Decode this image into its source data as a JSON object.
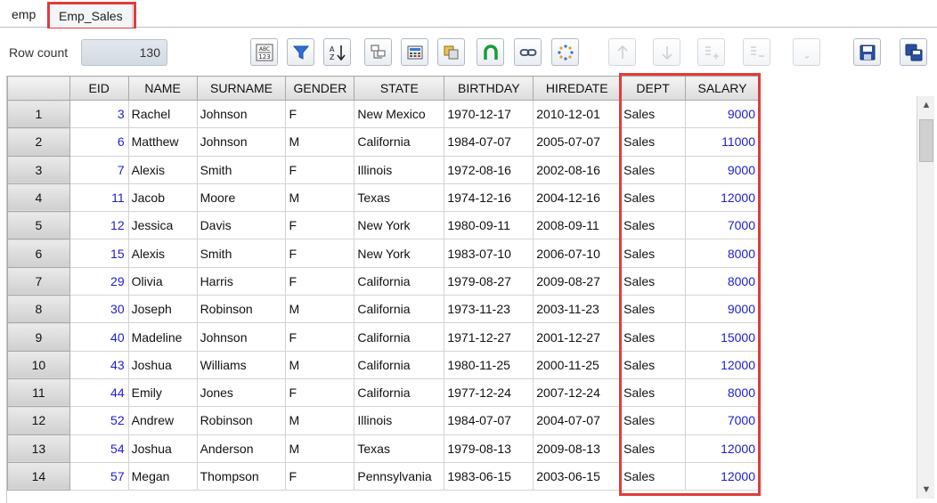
{
  "tabs": [
    {
      "label": "emp"
    },
    {
      "label": "Emp_Sales"
    }
  ],
  "toolbar": {
    "row_count_label": "Row count",
    "row_count_value": "130",
    "buttons": [
      {
        "icon": "abc-123-icon"
      },
      {
        "icon": "filter-icon"
      },
      {
        "icon": "sort-az-icon"
      },
      {
        "icon": "group-icon"
      },
      {
        "icon": "calculator-icon"
      },
      {
        "icon": "copy-icon"
      },
      {
        "icon": "magnet-icon"
      },
      {
        "icon": "link-icon"
      },
      {
        "icon": "dots-circle-icon"
      },
      {
        "icon": "move-up-icon"
      },
      {
        "icon": "move-down-icon"
      },
      {
        "icon": "insert-row-icon"
      },
      {
        "icon": "delete-row-icon"
      },
      {
        "icon": "blank-icon"
      },
      {
        "icon": "save-icon"
      },
      {
        "icon": "save-as-icon"
      }
    ]
  },
  "grid": {
    "columns": [
      "EID",
      "NAME",
      "SURNAME",
      "GENDER",
      "STATE",
      "BIRTHDAY",
      "HIREDATE",
      "DEPT",
      "SALARY"
    ],
    "rows": [
      {
        "n": "1",
        "eid": "3",
        "name": "Rachel",
        "surname": "Johnson",
        "gender": "F",
        "state": "New Mexico",
        "birthday": "1970-12-17",
        "hiredate": "2010-12-01",
        "dept": "Sales",
        "salary": "9000"
      },
      {
        "n": "2",
        "eid": "6",
        "name": "Matthew",
        "surname": "Johnson",
        "gender": "M",
        "state": "California",
        "birthday": "1984-07-07",
        "hiredate": "2005-07-07",
        "dept": "Sales",
        "salary": "11000"
      },
      {
        "n": "3",
        "eid": "7",
        "name": "Alexis",
        "surname": "Smith",
        "gender": "F",
        "state": "Illinois",
        "birthday": "1972-08-16",
        "hiredate": "2002-08-16",
        "dept": "Sales",
        "salary": "9000"
      },
      {
        "n": "4",
        "eid": "11",
        "name": "Jacob",
        "surname": "Moore",
        "gender": "M",
        "state": "Texas",
        "birthday": "1974-12-16",
        "hiredate": "2004-12-16",
        "dept": "Sales",
        "salary": "12000"
      },
      {
        "n": "5",
        "eid": "12",
        "name": "Jessica",
        "surname": "Davis",
        "gender": "F",
        "state": "New York",
        "birthday": "1980-09-11",
        "hiredate": "2008-09-11",
        "dept": "Sales",
        "salary": "7000"
      },
      {
        "n": "6",
        "eid": "15",
        "name": "Alexis",
        "surname": "Smith",
        "gender": "F",
        "state": "New York",
        "birthday": "1983-07-10",
        "hiredate": "2006-07-10",
        "dept": "Sales",
        "salary": "8000"
      },
      {
        "n": "7",
        "eid": "29",
        "name": "Olivia",
        "surname": "Harris",
        "gender": "F",
        "state": "California",
        "birthday": "1979-08-27",
        "hiredate": "2009-08-27",
        "dept": "Sales",
        "salary": "8000"
      },
      {
        "n": "8",
        "eid": "30",
        "name": "Joseph",
        "surname": "Robinson",
        "gender": "M",
        "state": "California",
        "birthday": "1973-11-23",
        "hiredate": "2003-11-23",
        "dept": "Sales",
        "salary": "9000"
      },
      {
        "n": "9",
        "eid": "40",
        "name": "Madeline",
        "surname": "Johnson",
        "gender": "F",
        "state": "California",
        "birthday": "1971-12-27",
        "hiredate": "2001-12-27",
        "dept": "Sales",
        "salary": "15000"
      },
      {
        "n": "10",
        "eid": "43",
        "name": "Joshua",
        "surname": "Williams",
        "gender": "M",
        "state": "California",
        "birthday": "1980-11-25",
        "hiredate": "2000-11-25",
        "dept": "Sales",
        "salary": "12000"
      },
      {
        "n": "11",
        "eid": "44",
        "name": "Emily",
        "surname": "Jones",
        "gender": "F",
        "state": "California",
        "birthday": "1977-12-24",
        "hiredate": "2007-12-24",
        "dept": "Sales",
        "salary": "8000"
      },
      {
        "n": "12",
        "eid": "52",
        "name": "Andrew",
        "surname": "Robinson",
        "gender": "M",
        "state": "Illinois",
        "birthday": "1984-07-07",
        "hiredate": "2004-07-07",
        "dept": "Sales",
        "salary": "7000"
      },
      {
        "n": "13",
        "eid": "54",
        "name": "Joshua",
        "surname": "Anderson",
        "gender": "M",
        "state": "Texas",
        "birthday": "1979-08-13",
        "hiredate": "2009-08-13",
        "dept": "Sales",
        "salary": "12000"
      },
      {
        "n": "14",
        "eid": "57",
        "name": "Megan",
        "surname": "Thompson",
        "gender": "F",
        "state": "Pennsylvania",
        "birthday": "1983-06-15",
        "hiredate": "2003-06-15",
        "dept": "Sales",
        "salary": "12000"
      }
    ]
  },
  "colors": {
    "highlight": "#e23b3b",
    "numeric_text": "#1d1dd6"
  }
}
